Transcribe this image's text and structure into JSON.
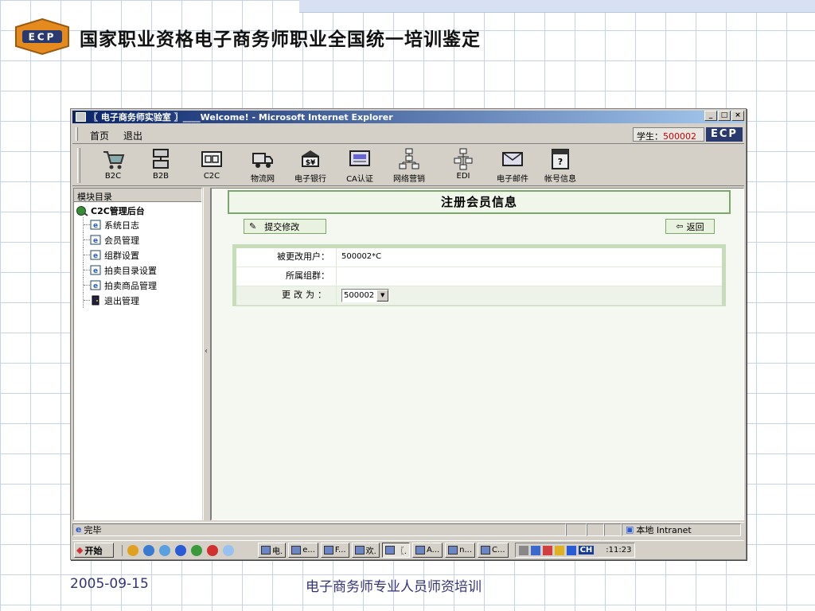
{
  "slide": {
    "title": "国家职业资格电子商务师职业全国统一培训鉴定",
    "footer_date": "2005-09-15",
    "footer_caption": "电子商务师专业人员师资培训"
  },
  "window": {
    "title": "〖 电子商务师实验室 〗____Welcome! - Microsoft Internet Explorer"
  },
  "menu": {
    "items": [
      "首页",
      "退出"
    ],
    "student_label": "学生：",
    "student_id": "500002",
    "badge": "ECP"
  },
  "toolbar": {
    "tools": [
      {
        "label": "B2C",
        "icon": "cart-icon"
      },
      {
        "label": "B2B",
        "icon": "b2b-icon"
      },
      {
        "label": "C2C",
        "icon": "c2c-icon"
      },
      {
        "label": "物流网",
        "icon": "truck-icon"
      },
      {
        "label": "电子银行",
        "icon": "bank-icon"
      },
      {
        "label": "CA认证",
        "icon": "ca-icon"
      },
      {
        "label": "网络营销",
        "icon": "network-icon"
      },
      {
        "label": "EDI",
        "icon": "edi-icon"
      },
      {
        "label": "电子邮件",
        "icon": "mail-icon"
      },
      {
        "label": "帐号信息",
        "icon": "help-icon"
      }
    ]
  },
  "sidebar": {
    "header": "模块目录",
    "root": "C2C管理后台",
    "items": [
      "系统日志",
      "会员管理",
      "组群设置",
      "拍卖目录设置",
      "拍卖商品管理",
      "退出管理"
    ]
  },
  "main": {
    "title": "注册会员信息",
    "submit_label": "提交修改",
    "back_label": "返回",
    "form": {
      "user_label": "被更改用户：",
      "user_value": "500002*C",
      "group_label": "所属组群：",
      "group_value": "",
      "change_label": "更改为：",
      "change_value": "500002"
    }
  },
  "status": {
    "text": "完毕",
    "zone": "本地 Intranet"
  },
  "taskbar": {
    "start": "开始",
    "tasks": [
      "电.",
      "e...",
      "F...",
      "欢.",
      "〖.",
      "A...",
      "n...",
      "C..."
    ],
    "lang": "CH",
    "clock": ":11:23"
  },
  "colors": {
    "title_green": "#7aa86a",
    "student_id_red": "#cc0000",
    "titlebar_blue": "#0a246a"
  }
}
